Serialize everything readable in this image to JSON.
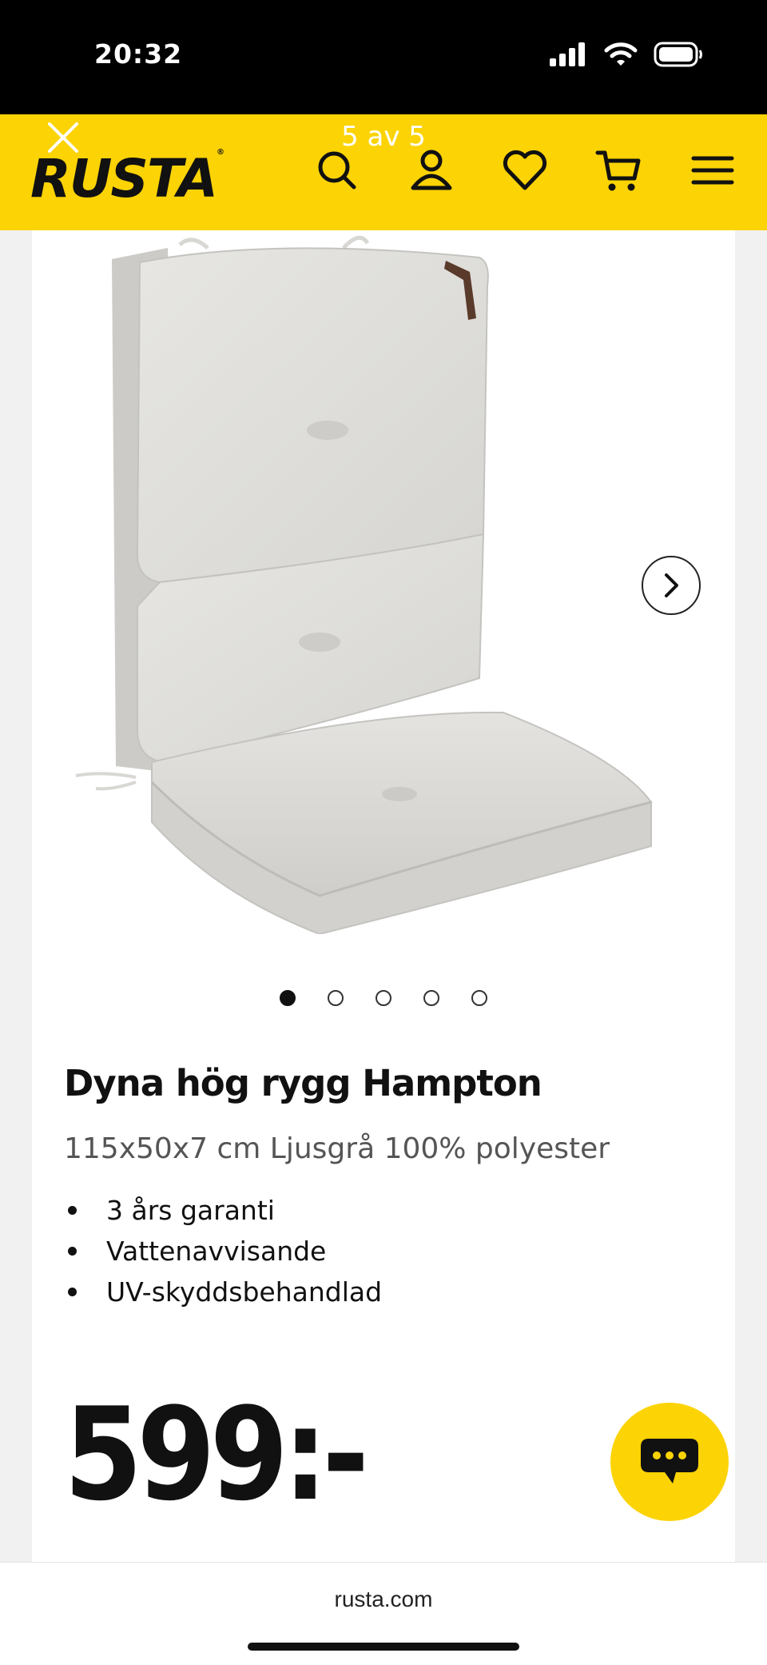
{
  "status_bar": {
    "time": "20:32",
    "icons": [
      "signal-icon",
      "wifi-icon",
      "battery-icon"
    ]
  },
  "header": {
    "logo": "RUSTA",
    "logo_mark": "®",
    "slide_counter": "5 av 5",
    "icons": [
      "close-icon",
      "search-icon",
      "user-icon",
      "heart-icon",
      "cart-icon",
      "menu-icon"
    ]
  },
  "product": {
    "title": "Dyna hög rygg Hampton",
    "subtitle": "115x50x7 cm Ljusgrå 100% polyester",
    "features": [
      "3 års garanti",
      "Vattenavvisande",
      "UV-skyddsbehandlad"
    ],
    "price": "599:-"
  },
  "carousel": {
    "total": 5,
    "active_index": 1
  },
  "browser": {
    "url": "rusta.com"
  },
  "colors": {
    "brand_yellow": "#fcd304",
    "text_dark": "#111111",
    "text_muted": "#555555"
  }
}
